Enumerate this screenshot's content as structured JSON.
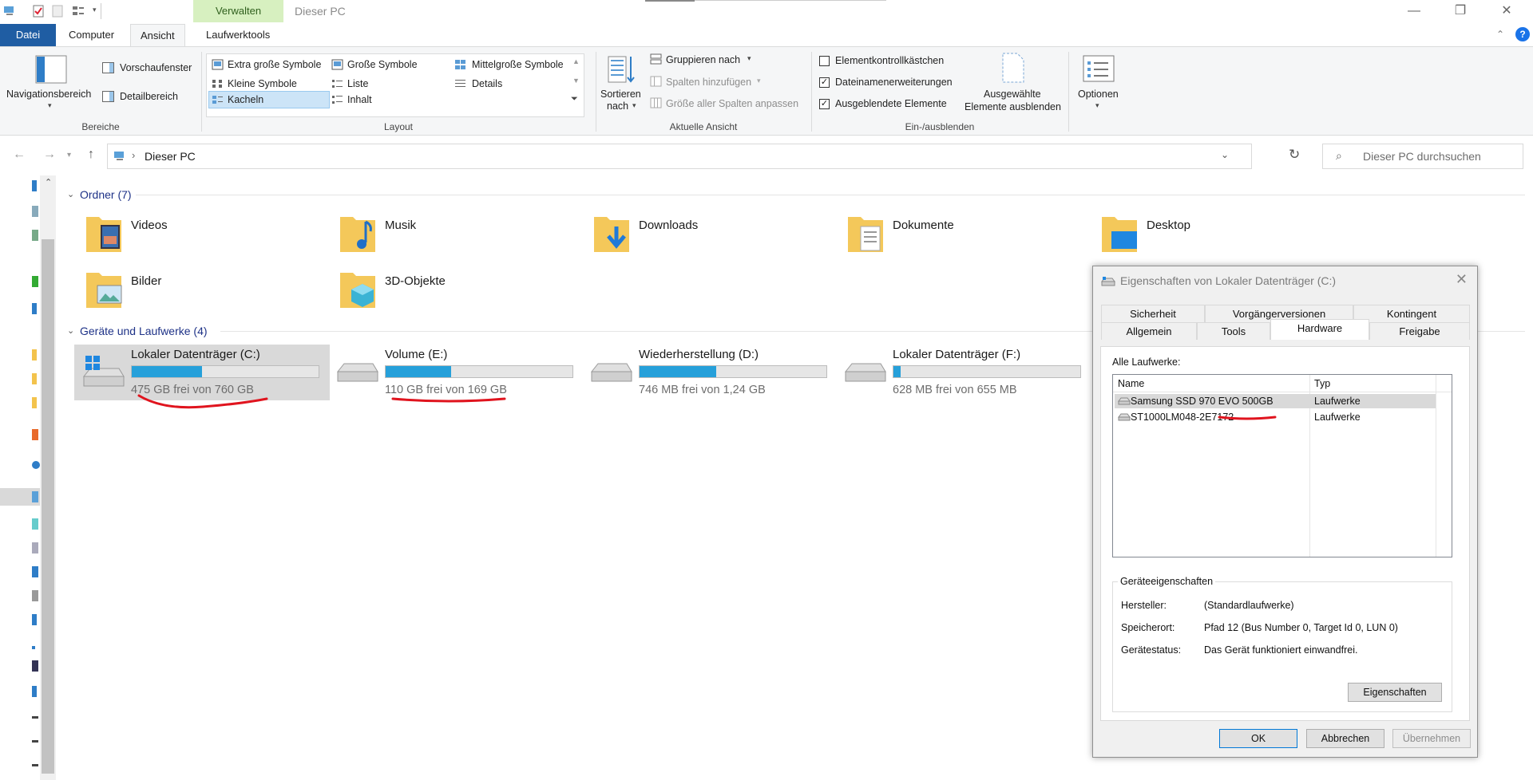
{
  "window": {
    "title": "Dieser PC",
    "context_group": "Verwalten",
    "controls": {
      "minimize": "—",
      "restore": "❐",
      "close": "✕"
    }
  },
  "ribbon_tabs": {
    "file": "Datei",
    "computer": "Computer",
    "view": "Ansicht",
    "drive_tools": "Laufwerktools"
  },
  "ribbon": {
    "bereiche": {
      "label": "Bereiche",
      "nav_pane": "Navigationsbereich",
      "preview": "Vorschaufenster",
      "details_pane": "Detailbereich"
    },
    "layout": {
      "label": "Layout",
      "items": [
        "Extra große Symbole",
        "Große Symbole",
        "Mittelgroße Symbole",
        "Kleine Symbole",
        "Liste",
        "Details",
        "Kacheln",
        "Inhalt"
      ]
    },
    "current_view": {
      "label": "Aktuelle Ansicht",
      "sort_line1": "Sortieren",
      "sort_line2": "nach",
      "group_by": "Gruppieren nach",
      "add_columns": "Spalten hinzufügen",
      "fit_columns": "Größe aller Spalten anpassen"
    },
    "show_hide": {
      "label": "Ein-/ausblenden",
      "item_checkboxes": "Elementkontrollkästchen",
      "extensions": "Dateinamenerweiterungen",
      "hidden_items": "Ausgeblendete Elemente",
      "hide_selected_1": "Ausgewählte",
      "hide_selected_2": "Elemente ausblenden"
    },
    "options": "Optionen"
  },
  "address": {
    "path": "Dieser PC",
    "search_placeholder": "Dieser PC durchsuchen"
  },
  "folders": {
    "header": "Ordner (7)",
    "items": [
      "Videos",
      "Musik",
      "Downloads",
      "Dokumente",
      "Desktop",
      "Bilder",
      "3D-Objekte"
    ]
  },
  "drives": {
    "header": "Geräte und Laufwerke (4)",
    "items": [
      {
        "name": "Lokaler Datenträger (C:)",
        "free": "475 GB frei von 760 GB",
        "used_fraction": 0.375
      },
      {
        "name": "Volume (E:)",
        "free": "110 GB frei von 169 GB",
        "used_fraction": 0.35
      },
      {
        "name": "Wiederherstellung (D:)",
        "free": "746 MB frei von 1,24 GB",
        "used_fraction": 0.41
      },
      {
        "name": "Lokaler Datenträger (F:)",
        "free": "628 MB frei von 655 MB",
        "used_fraction": 0.04
      }
    ]
  },
  "dialog": {
    "title": "Eigenschaften von Lokaler Datenträger (C:)",
    "tabs_row1": [
      "Sicherheit",
      "Vorgängerversionen",
      "Kontingent"
    ],
    "tabs_row2": [
      "Allgemein",
      "Tools",
      "Hardware",
      "Freigabe"
    ],
    "all_drives_label": "Alle Laufwerke:",
    "columns": [
      "Name",
      "Typ"
    ],
    "rows": [
      {
        "name": "Samsung SSD 970 EVO 500GB",
        "type": "Laufwerke"
      },
      {
        "name": "ST1000LM048-2E7172",
        "type": "Laufwerke"
      }
    ],
    "device_props_label": "Geräteeigenschaften",
    "manufacturer_label": "Hersteller:",
    "manufacturer": "(Standardlaufwerke)",
    "location_label": "Speicherort:",
    "location": "Pfad 12 (Bus Number 0, Target Id 0, LUN 0)",
    "status_label": "Gerätestatus:",
    "status": "Das Gerät funktioniert einwandfrei.",
    "properties_button": "Eigenschaften",
    "ok": "OK",
    "cancel": "Abbrechen",
    "apply": "Übernehmen"
  },
  "colors": {
    "accent": "#1f5da3",
    "drive_fill": "#26a0da",
    "context_tab": "#d7f0c0",
    "annotation_red": "#e0141e"
  }
}
